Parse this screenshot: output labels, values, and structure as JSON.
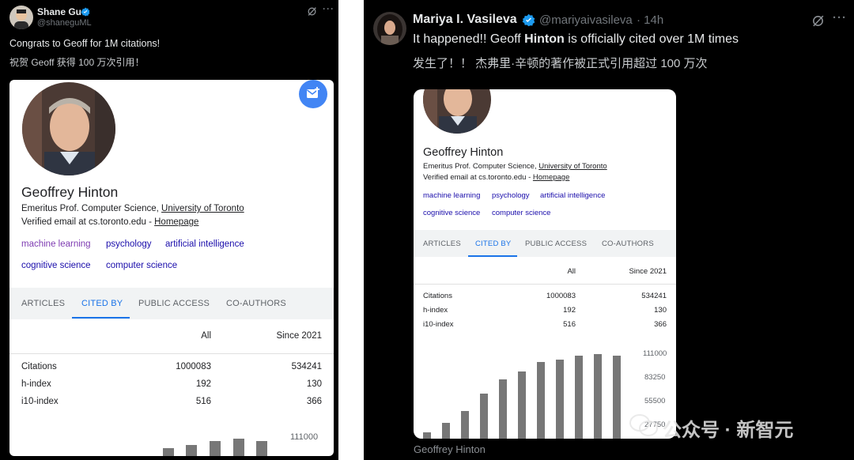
{
  "left": {
    "author": {
      "name": "Shane Gu",
      "handle": "@shaneguML"
    },
    "text_en": "Congrats to Geoff for 1M citations!",
    "text_zh": "祝贺 Geoff 获得 100 万次引用！",
    "scholar": {
      "name": "Geoffrey Hinton",
      "affiliation_prefix": "Emeritus Prof. Computer Science, ",
      "affiliation_link": "University of Toronto",
      "email_prefix": "Verified email at cs.toronto.edu - ",
      "homepage": "Homepage",
      "topics": [
        "machine learning",
        "psychology",
        "artificial intelligence",
        "cognitive science",
        "computer science"
      ],
      "tabs": [
        "ARTICLES",
        "CITED BY",
        "PUBLIC ACCESS",
        "CO-AUTHORS"
      ],
      "col_all": "All",
      "col_since": "Since 2021",
      "rows": [
        {
          "label": "Citations",
          "all": "1000083",
          "since": "534241"
        },
        {
          "label": "h-index",
          "all": "192",
          "since": "130"
        },
        {
          "label": "i10-index",
          "all": "516",
          "since": "366"
        }
      ],
      "axis_top": "111000"
    }
  },
  "right": {
    "author": {
      "name": "Mariya I. Vasileva",
      "handle": "@mariyaivasileva",
      "time": "· 14h"
    },
    "text_en_pre": "It happened!! Geoff ",
    "text_en_bold": "Hinton",
    "text_en_post": " is officially cited over 1M times",
    "text_zh": "发生了！！ 杰弗里·辛顿的著作被正式引用超过 100 万次",
    "scholar": {
      "name": "Geoffrey Hinton",
      "affiliation_prefix": "Emeritus Prof. Computer Science, ",
      "affiliation_link": "University of Toronto",
      "email_prefix": "Verified email at cs.toronto.edu - ",
      "homepage": "Homepage",
      "topics": [
        "machine learning",
        "psychology",
        "artificial intelligence",
        "cognitive science",
        "computer science"
      ],
      "tabs": [
        "ARTICLES",
        "CITED BY",
        "PUBLIC ACCESS",
        "CO-AUTHORS"
      ],
      "col_all": "All",
      "col_since": "Since 2021",
      "rows": [
        {
          "label": "Citations",
          "all": "1000083",
          "since": "534241"
        },
        {
          "label": "h-index",
          "all": "192",
          "since": "130"
        },
        {
          "label": "i10-index",
          "all": "516",
          "since": "366"
        }
      ],
      "axis_ticks": [
        "111000",
        "83250",
        "55500",
        "27750"
      ]
    },
    "caption": "Geoffrey Hinton"
  },
  "watermark": "公众号 · 新智元",
  "colors": {
    "verified": "#1d9bf0",
    "link": "#1a0dab",
    "active_tab": "#1a73e8",
    "bar": "#777777"
  }
}
